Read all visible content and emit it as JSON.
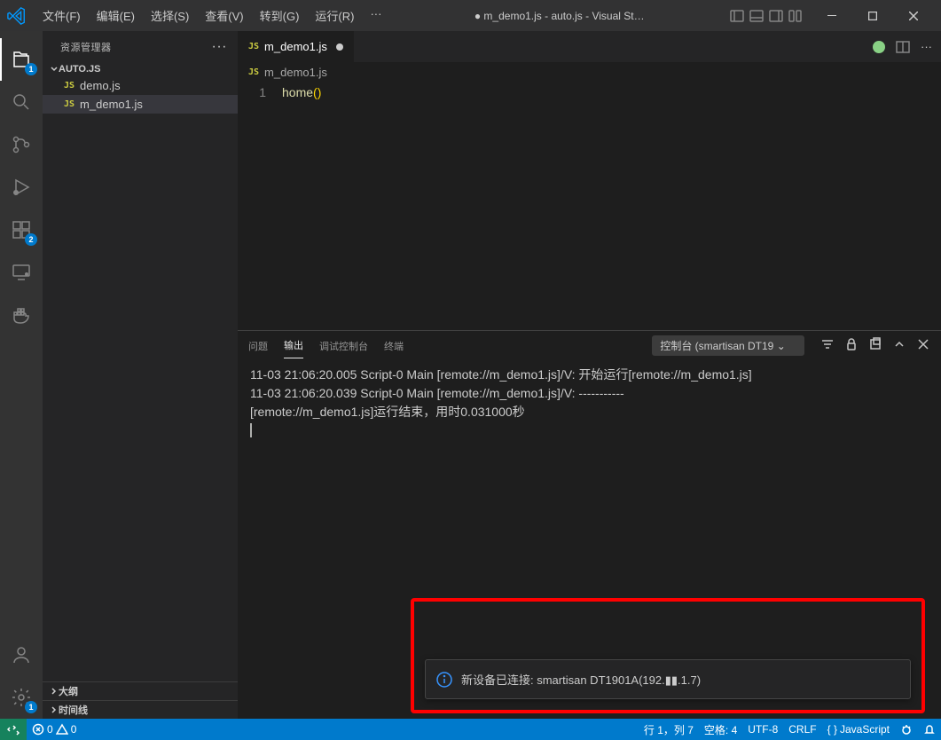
{
  "titlebar": {
    "menu": [
      "文件(F)",
      "编辑(E)",
      "选择(S)",
      "查看(V)",
      "转到(G)",
      "运行(R)",
      "···"
    ],
    "title": "● m_demo1.js - auto.js - Visual St…"
  },
  "sidebar": {
    "title": "资源管理器",
    "folder": "AUTO.JS",
    "files": [
      "demo.js",
      "m_demo1.js"
    ],
    "outline": "大纲",
    "timeline": "时间线"
  },
  "activity": {
    "explorer_badge": "1",
    "ext_badge": "2",
    "settings_badge": "1"
  },
  "tabs": {
    "tab1": "m_demo1.js"
  },
  "breadcrumb": {
    "file": "m_demo1.js"
  },
  "editor": {
    "line1_num": "1",
    "line1_fn": "home",
    "line1_paren": "()"
  },
  "panel": {
    "tabs": {
      "problems": "问题",
      "output": "输出",
      "debug": "调试控制台",
      "terminal": "终端"
    },
    "selector": "控制台 (smartisan DT19",
    "log": "11-03 21:06:20.005 Script-0 Main [remote://m_demo1.js]/V: 开始运行[remote://m_demo1.js]\n11-03 21:06:20.039 Script-0 Main [remote://m_demo1.js]/V: -----------\n[remote://m_demo1.js]运行结束，用时0.031000秒"
  },
  "notification": {
    "text": "新设备已连接: smartisan DT1901A(192.▮▮.1.7)"
  },
  "statusbar": {
    "errors": "0",
    "warnings": "0",
    "position": "行 1，列 7",
    "spaces": "空格: 4",
    "encoding": "UTF-8",
    "eol": "CRLF",
    "lang": "JavaScript"
  }
}
